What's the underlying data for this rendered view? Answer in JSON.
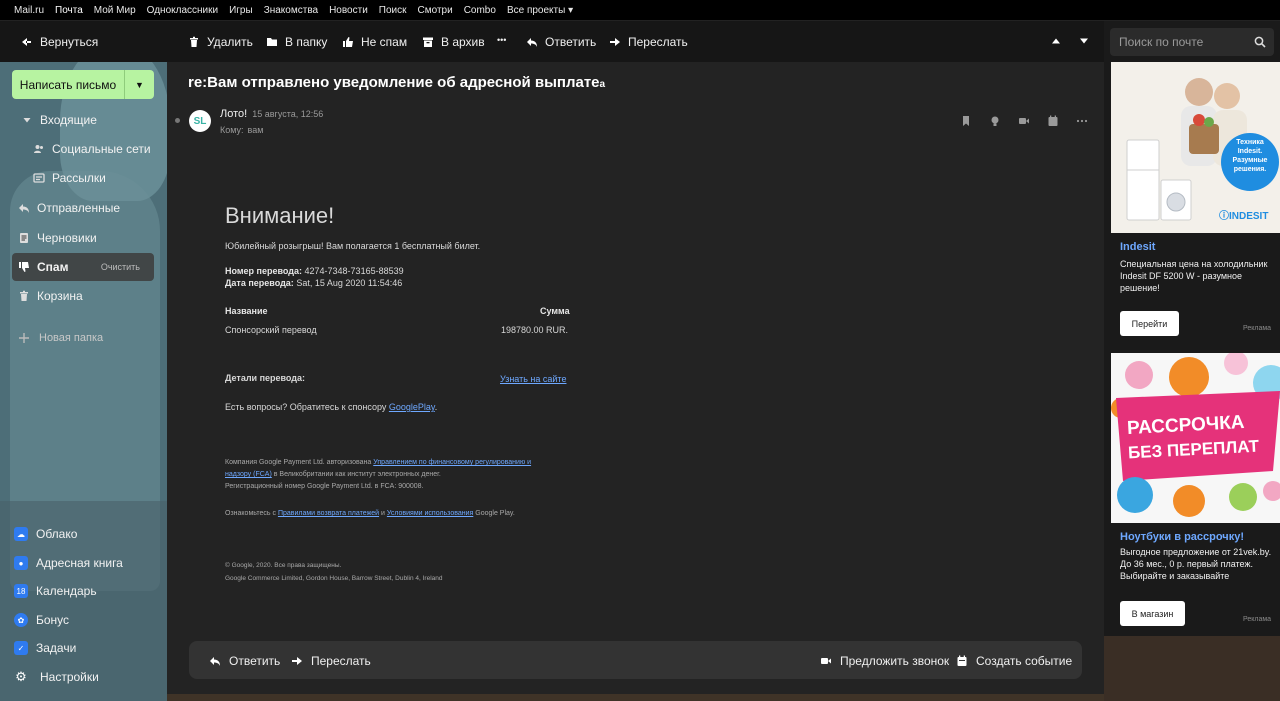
{
  "portal": {
    "links": [
      "Mail.ru",
      "Почта",
      "Мой Мир",
      "Одноклассники",
      "Игры",
      "Знакомства",
      "Новости",
      "Поиск",
      "Смотри",
      "Combo",
      "Все проекты ▾"
    ]
  },
  "toolbar": {
    "back_label": "Вернуться",
    "delete_label": "Удалить",
    "move_label": "В папку",
    "notspam_label": "Не спам",
    "archive_label": "В архив",
    "more_label": "•••",
    "reply_label": "Ответить",
    "forward_label": "Переслать"
  },
  "search": {
    "placeholder": "Поиск по почте"
  },
  "sidebar": {
    "compose_label": "Написать письмо",
    "folders": {
      "inbox": "Входящие",
      "social": "Социальные сети",
      "newsletters": "Рассылки",
      "sent": "Отправленные",
      "drafts": "Черновики",
      "spam": "Спам",
      "spam_clear": "Очистить",
      "trash": "Корзина",
      "new_folder": "Новая папка"
    },
    "services": {
      "cloud": "Облако",
      "contacts": "Адресная книга",
      "calendar": "Календарь",
      "calendar_day": "18",
      "bonus": "Бонус",
      "tasks": "Задачи",
      "settings": "Настройки"
    }
  },
  "message": {
    "subject": "re:Вам отправлено уведомление об адресной выплате",
    "subject_suffix": "a",
    "avatar_initials": "SL",
    "sender": "Лото!",
    "date": "15 августа, 12:56",
    "to_label": "Кому:",
    "to_value": "вам",
    "body": {
      "heading": "Внимание!",
      "intro": "Юбилейный розыгрыш! Вам полагается 1 бесплатный билет.",
      "transfer_number_label": "Номер перевода:",
      "transfer_number": "4274-7348-73165-88539",
      "transfer_date_label": "Дата перевода:",
      "transfer_date": "Sat, 15 Aug 2020 11:54:46",
      "table_col_name": "Название",
      "table_col_sum": "Сумма",
      "table_row_name": "Спонсорский перевод",
      "table_row_sum": "198780.00 RUR.",
      "details_label": "Детали перевода:",
      "details_link": "Узнать на сайте",
      "questions_text": "Есть вопросы? Обратитесь к спонсору",
      "questions_link": "GooglePlay",
      "questions_end": ".",
      "legal1_pre": "Компания Google Payment Ltd. авторизована",
      "legal1_link": "Управлением по финансовому регулированию и",
      "legal2_link": "надзору (FCA)",
      "legal2_post": "в Великобритании как институт электронных денег.",
      "legal3": "Регистрационный номер Google Payment Ltd. в FCA: 900008.",
      "legal4_pre": "Ознакомьтесь с",
      "legal4_link1": "Правилами возврата платежей",
      "legal4_mid": "и",
      "legal4_link2": "Условиями использования",
      "legal4_post": "Google Play.",
      "copyright": "© Google, 2020. Все права защищены.",
      "address": "Google Commerce Limited, Gordon House, Barrow Street, Dublin 4, Ireland"
    },
    "footer": {
      "reply_label": "Ответить",
      "forward_label": "Переслать",
      "call_label": "Предложить звонок",
      "event_label": "Создать событие"
    }
  },
  "ads": [
    {
      "title": "Indesit",
      "text": "Специальная цена на холодильник Indesit DF 5200 W - разумное решение!",
      "button": "Перейти",
      "label": "Реклама",
      "image_text": [
        "Техника",
        "Indesit.",
        "Разумные",
        "решения."
      ],
      "brand": "INDESIT"
    },
    {
      "title": "Ноутбуки в рассрочку!",
      "text": "Выгодное предложение от 21vek.by. До 36 мес., 0 р. первый платеж. Выбирайте и заказывайте",
      "button": "В магазин",
      "label": "Реклама",
      "image_text": [
        "РАССРОЧКА",
        "БЕЗ ПЕРЕПЛАТ"
      ]
    }
  ],
  "colors": {
    "accent": "#b7f3a1",
    "link": "#6ea8ff",
    "panel": "#232323"
  }
}
